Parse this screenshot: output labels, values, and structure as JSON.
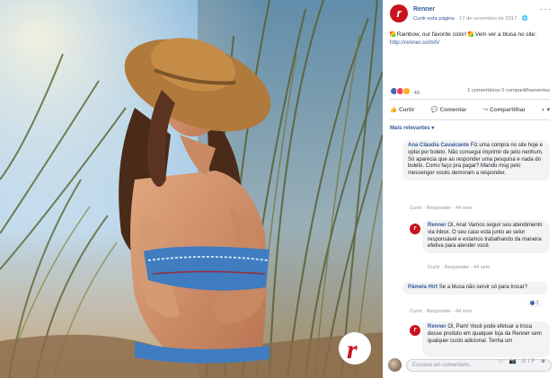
{
  "post": {
    "page_name": "Renner",
    "follow_link": "Curtir esta página",
    "date": "17 de novembro de 2017",
    "globe": "🌐",
    "more": "···",
    "logo_letter": "r",
    "text_1": "Rainbow, our favorite color",
    "text_2": "Vem ver a blusa no site:",
    "link": "http://renner.co/mlV",
    "reaction_count": "40",
    "comments_count": "1 comentários",
    "shares_count": "0 compartilhamentos",
    "actions": [
      {
        "label": "Curtir",
        "icon": "👍"
      },
      {
        "label": "Comentar",
        "icon": "💬"
      },
      {
        "label": "Compartilhar",
        "icon": "↪"
      }
    ],
    "filter_label": "Mais relevantes ▾"
  },
  "comments": [
    {
      "author": "Ana Cláudia Cavalcante",
      "text": "Fiz uma compra no site hoje e optei por boleto. Não consegui imprimir de jeito nenhum. Só aparecia que ao responder uma pesquisa e nada do boleto. Como faço pra pagar? Mando msg pelo messenger vocês demoram a responder.",
      "meta": "Curtir · Responder · 44 sem"
    },
    {
      "author": "Renner",
      "text": "Oi, Ana! Vamos seguir seu atendimento via inbox. O seu caso está junto ao setor responsável e estamos trabalhando da maneira efetiva para atender você.",
      "meta": "Curtir · Responder · 44 sem"
    },
    {
      "author": "Pâmela Hirt",
      "text": "Se a blusa não servir só para trocar?",
      "meta": "Curtir · Responder · 44 sem",
      "likes": "1"
    },
    {
      "author": "Renner",
      "text": "Oi, Pam! Você pode efetuar a troca desse produto em qualquer loja da Renner sem qualquer custo adicional. Tenha um"
    }
  ],
  "composer": {
    "placeholder": "Escreva um comentário...",
    "icons": "☺ 📷 GIF ☻"
  },
  "colors": {
    "accent": "#365899",
    "brand_red": "#c7141e"
  }
}
